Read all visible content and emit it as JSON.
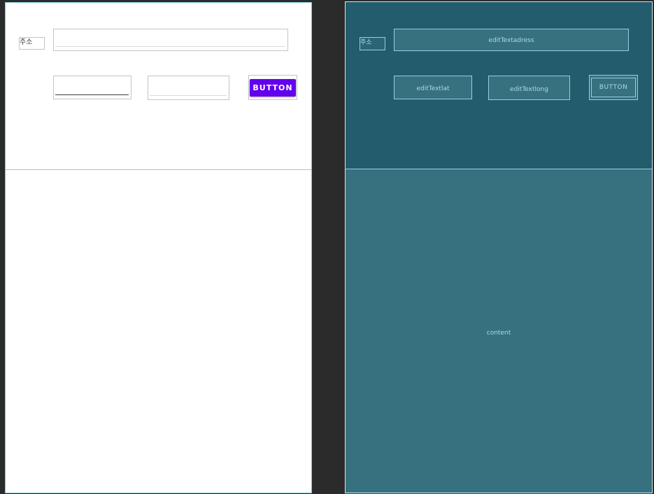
{
  "design_view": {
    "address_label": "주소",
    "address_input": {
      "value": ""
    },
    "lat_input": {
      "value": ""
    },
    "long_input": {
      "value": ""
    },
    "button_label": "BUTTON",
    "button_color": "#6200ee"
  },
  "blueprint_view": {
    "address_label": "주소",
    "address_input_id": "editTextadress",
    "lat_input_id": "editTextlat",
    "long_input_id": "editTextlong",
    "button_label": "BUTTON",
    "content_label": "content"
  },
  "colors": {
    "blueprint_top": "#225c6d",
    "blueprint_bottom": "#37707f",
    "blueprint_line": "#8fd2e0",
    "editor_background": "#2b2b2b"
  }
}
